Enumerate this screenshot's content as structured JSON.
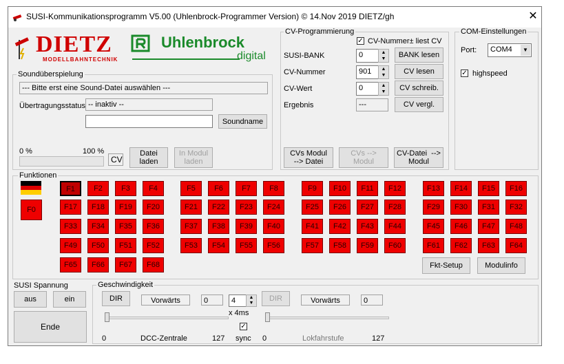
{
  "window": {
    "title": "SUSI-Kommunikationsprogramm V5.00   (Uhlenbrock-Programmer Version)  © 14.Nov 2019 DIETZ/gh",
    "close_glyph": "✕"
  },
  "logos": {
    "dietz": "DIETZ",
    "dietz_sub": "MODELLBAHNTECHNIK",
    "uhlenbrock": "Uhlenbrock",
    "uhlenbrock_sub": "digital"
  },
  "sound": {
    "group_label": "Soundüberspielung",
    "file_prompt": "--- Bitte erst eine Sound-Datei auswählen ---",
    "status_label": "Übertragungsstatus",
    "status_value": "-- inaktiv --",
    "name_value": "",
    "soundname_button": "Soundname",
    "pct_min": "0 %",
    "pct_max": "100 %",
    "cv_label": "CV",
    "load_button": "Datei\nladen",
    "module_load_button": "In Modul\nladen",
    "progress": 0
  },
  "cv": {
    "group_label": "CV-Programmierung",
    "liest_cv_label": "CV-Nummer± liest CV",
    "liest_cv_checked": true,
    "bank_label": "SUSI-BANK",
    "bank_value": "0",
    "bank_button": "BANK lesen",
    "nummer_label": "CV-Nummer",
    "nummer_value": "901",
    "read_button": "CV lesen",
    "wert_label": "CV-Wert",
    "wert_value": "0",
    "write_button": "CV schreib.",
    "ergebnis_label": "Ergebnis",
    "ergebnis_value": "---",
    "compare_button": "CV vergl.",
    "cvs_modul_datei": "CVs Modul\n--> Datei",
    "cvs_to_modul": "CVs -->\nModul",
    "cv_datei_modul": "CV-Datei  -->\nModul"
  },
  "com": {
    "group_label": "COM-Einstellungen",
    "port_label": "Port:",
    "port_value": "COM4",
    "highspeed_label": "highspeed",
    "highspeed_checked": true
  },
  "funktionen": {
    "group_label": "Funktionen",
    "f0": "F0",
    "rows": [
      [
        "F1",
        "F2",
        "F3",
        "F4",
        "F5",
        "F6",
        "F7",
        "F8",
        "F9",
        "F10",
        "F11",
        "F12",
        "F13",
        "F14",
        "F15",
        "F16"
      ],
      [
        "F17",
        "F18",
        "F19",
        "F20",
        "F21",
        "F22",
        "F23",
        "F24",
        "F25",
        "F26",
        "F27",
        "F28",
        "F29",
        "F30",
        "F31",
        "F32"
      ],
      [
        "F33",
        "F34",
        "F35",
        "F36",
        "F37",
        "F38",
        "F39",
        "F40",
        "F41",
        "F42",
        "F43",
        "F44",
        "F45",
        "F46",
        "F47",
        "F48"
      ],
      [
        "F49",
        "F50",
        "F51",
        "F52",
        "F53",
        "F54",
        "F55",
        "F56",
        "F57",
        "F58",
        "F59",
        "F60",
        "F61",
        "F62",
        "F63",
        "F64"
      ],
      [
        "F65",
        "F66",
        "F67",
        "F68"
      ]
    ],
    "selected": "F1",
    "fkt_setup_button": "Fkt-Setup",
    "modulinfo_button": "Modulinfo"
  },
  "spannung": {
    "group_label": "SUSI Spannung",
    "aus_button": "aus",
    "ein_button": "ein",
    "ende_button": "Ende"
  },
  "speed": {
    "group_label": "Geschwindigkeit",
    "dir1_button": "DIR",
    "dir1_value": "Vorwärts",
    "speed1_value": "0",
    "step_value": "4",
    "step_label": "x 4ms",
    "dir2_button": "DIR",
    "dir2_value": "Vorwärts",
    "speed2_value": "0",
    "left_min": "0",
    "left_caption": "DCC-Zentrale",
    "left_max": "127",
    "sync_label": "sync",
    "sync_checked": true,
    "right_min": "0",
    "right_caption": "Lokfahrstufe",
    "right_max": "127",
    "left_level": 0,
    "right_level": 0
  }
}
